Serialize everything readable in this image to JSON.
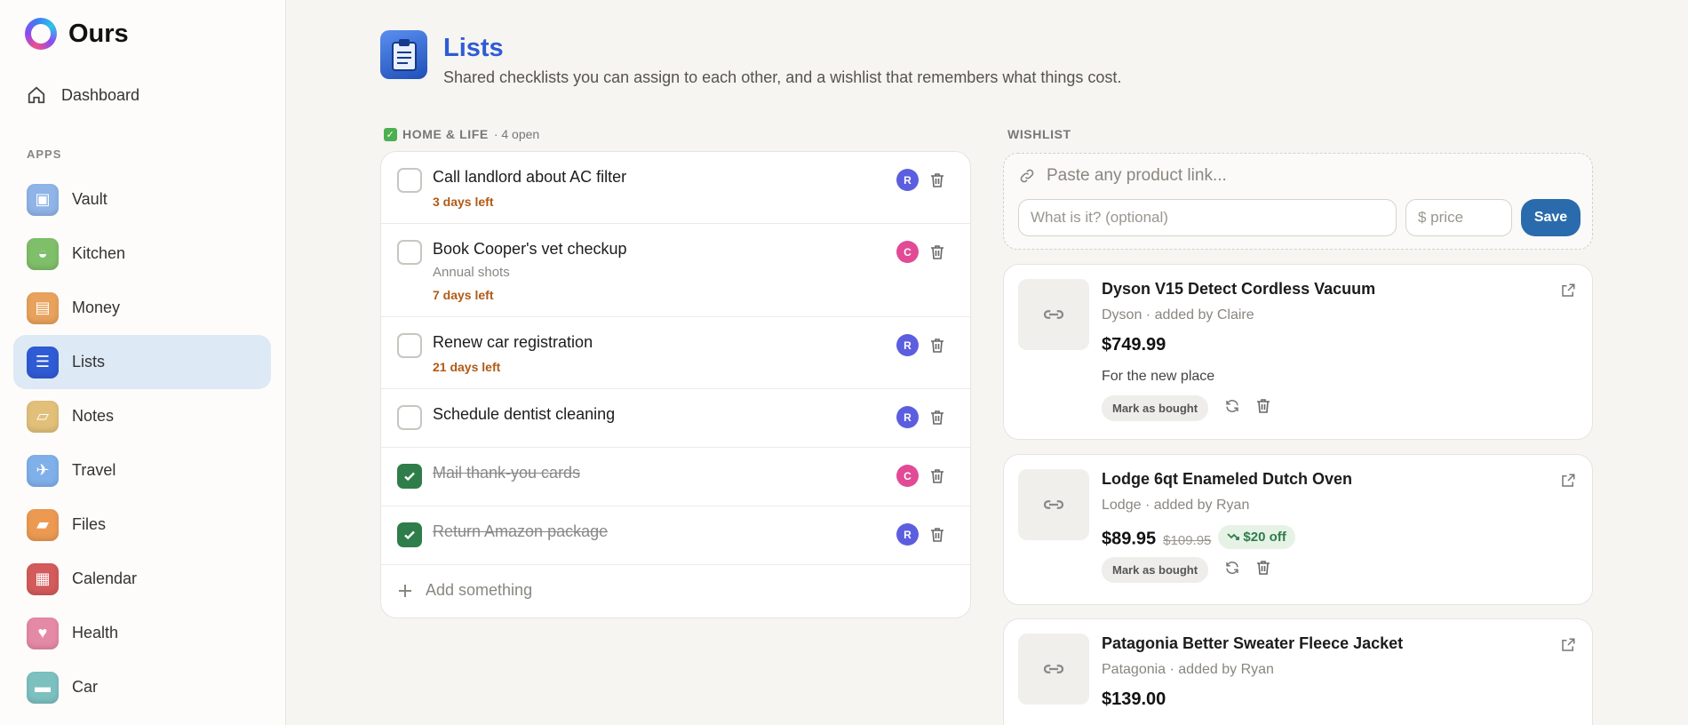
{
  "app": {
    "name": "Ours"
  },
  "sidebar": {
    "dashboard_label": "Dashboard",
    "apps_heading": "APPS",
    "items": [
      {
        "label": "Vault",
        "icon": "vault-icon",
        "color": "#8fb4e8"
      },
      {
        "label": "Kitchen",
        "icon": "pot-icon",
        "color": "#7fbf6a"
      },
      {
        "label": "Money",
        "icon": "wallet-icon",
        "color": "#e8a25c"
      },
      {
        "label": "Lists",
        "icon": "clipboard-icon",
        "color": "#2f5bd4"
      },
      {
        "label": "Notes",
        "icon": "note-icon",
        "color": "#e2c07a"
      },
      {
        "label": "Travel",
        "icon": "plane-icon",
        "color": "#7fb0ea"
      },
      {
        "label": "Files",
        "icon": "folder-icon",
        "color": "#ec9a52"
      },
      {
        "label": "Calendar",
        "icon": "calendar-icon",
        "color": "#d35b5b"
      },
      {
        "label": "Health",
        "icon": "heart-icon",
        "color": "#e58aa6"
      },
      {
        "label": "Car",
        "icon": "car-icon",
        "color": "#7cc0c0"
      }
    ],
    "active": "Lists"
  },
  "header": {
    "title": "Lists",
    "subtitle": "Shared checklists you can assign to each other, and a wishlist that remembers what things cost."
  },
  "todo": {
    "section_title": "HOME & LIFE",
    "count_label": "· 4 open",
    "add_label": "Add something",
    "items": [
      {
        "title": "Call landlord about AC filter",
        "note": "",
        "due": "3 days left",
        "assignee": "R",
        "done": false
      },
      {
        "title": "Book Cooper's vet checkup",
        "note": "Annual shots",
        "due": "7 days left",
        "assignee": "C",
        "done": false
      },
      {
        "title": "Renew car registration",
        "note": "",
        "due": "21 days left",
        "assignee": "R",
        "done": false
      },
      {
        "title": "Schedule dentist cleaning",
        "note": "",
        "due": "",
        "assignee": "R",
        "done": false
      },
      {
        "title": "Mail thank-you cards",
        "note": "",
        "due": "",
        "assignee": "C",
        "done": true
      },
      {
        "title": "Return Amazon package",
        "note": "",
        "due": "",
        "assignee": "R",
        "done": true
      }
    ]
  },
  "wishlist": {
    "section_title": "WISHLIST",
    "link_placeholder": "Paste any product link...",
    "name_placeholder": "What is it? (optional)",
    "price_placeholder": "$ price",
    "save_label": "Save",
    "mark_label": "Mark as bought",
    "items": [
      {
        "title": "Dyson V15 Detect Cordless Vacuum",
        "meta": "Dyson · added by Claire",
        "price": "$749.99",
        "old_price": "",
        "discount": "",
        "note": "For the new place"
      },
      {
        "title": "Lodge 6qt Enameled Dutch Oven",
        "meta": "Lodge · added by Ryan",
        "price": "$89.95",
        "old_price": "$109.95",
        "discount": "$20 off",
        "note": ""
      },
      {
        "title": "Patagonia Better Sweater Fleece Jacket",
        "meta": "Patagonia · added by Ryan",
        "price": "$139.00",
        "old_price": "",
        "discount": "",
        "note": ""
      }
    ]
  }
}
